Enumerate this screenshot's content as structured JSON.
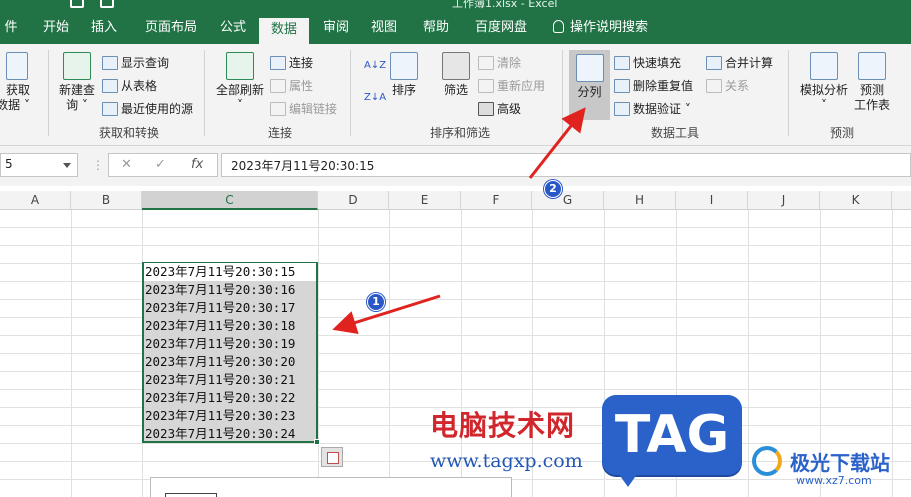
{
  "window": {
    "title": "工作簿1.xlsx  -  Excel"
  },
  "tabs": [
    "件",
    "开始",
    "插入",
    "页面布局",
    "公式",
    "数据",
    "审阅",
    "视图",
    "帮助",
    "百度网盘",
    "操作说明搜索"
  ],
  "active_tab": "数据",
  "ribbon": {
    "get_data": {
      "line1": "获取",
      "line2": "数据"
    },
    "new_query": {
      "line1": "新建查",
      "line2": "询"
    },
    "show_query": "显示查询",
    "from_table": "从表格",
    "recent_sources": "最近使用的源",
    "group_get_transform": "获取和转换",
    "refresh_all": "全部刷新",
    "connections": "连接",
    "properties": "属性",
    "edit_links": "编辑链接",
    "group_connections": "连接",
    "sort": "排序",
    "filter": "筛选",
    "clear": "清除",
    "reapply": "重新应用",
    "advanced": "高级",
    "group_sort_filter": "排序和筛选",
    "text_to_columns": "分列",
    "flash_fill": "快速填充",
    "remove_duplicates": "删除重复值",
    "data_validation": "数据验证",
    "consolidate": "合并计算",
    "relationships": "关系",
    "group_data_tools": "数据工具",
    "what_if": "模拟分析",
    "forecast_sheet": {
      "line1": "预测",
      "line2": "工作表"
    },
    "group_forecast": "预测"
  },
  "formula_bar": {
    "name_box": "5",
    "value": "2023年7月11号20:30:15",
    "fx": "fx"
  },
  "columns": [
    "A",
    "B",
    "C",
    "D",
    "E",
    "F",
    "G",
    "H",
    "I",
    "J",
    "K"
  ],
  "selected_column": "C",
  "cells": [
    "2023年7月11号20:30:15",
    "2023年7月11号20:30:16",
    "2023年7月11号20:30:17",
    "2023年7月11号20:30:18",
    "2023年7月11号20:30:19",
    "2023年7月11号20:30:20",
    "2023年7月11号20:30:21",
    "2023年7月11号20:30:22",
    "2023年7月11号20:30:23",
    "2023年7月11号20:30:24"
  ],
  "annotations": {
    "badge1": "1",
    "badge2": "2",
    "arrow_color": "#e0231f"
  },
  "watermark": {
    "cn": "电脑技术网",
    "url": "www.tagxp.com",
    "tag": "TAG",
    "site_cn": "极光下载站",
    "site_url": "www.xz7.com"
  },
  "colors": {
    "excel_green": "#217346",
    "badge_blue": "#2a57c7",
    "watermark_red": "#d0262c"
  }
}
